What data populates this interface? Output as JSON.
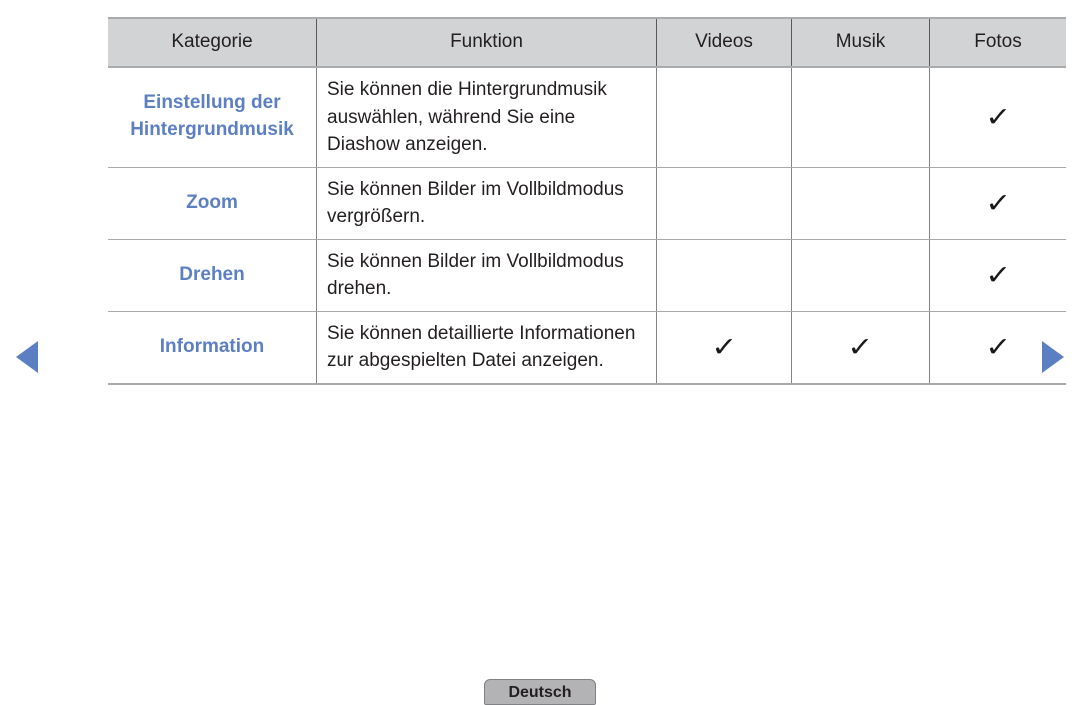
{
  "table": {
    "columns": [
      {
        "key": "kategorie",
        "label": "Kategorie"
      },
      {
        "key": "funktion",
        "label": "Funktion"
      },
      {
        "key": "videos",
        "label": "Videos"
      },
      {
        "key": "musik",
        "label": "Musik"
      },
      {
        "key": "fotos",
        "label": "Fotos"
      }
    ],
    "rows": [
      {
        "kategorie": "Einstellung der Hintergrundmusik",
        "funktion": "Sie können die Hintergrundmusik auswählen, während Sie eine Diashow anzeigen.",
        "videos": "",
        "musik": "",
        "fotos": "✓"
      },
      {
        "kategorie": "Zoom",
        "funktion": "Sie können Bilder im Vollbildmodus vergrößern.",
        "videos": "",
        "musik": "",
        "fotos": "✓"
      },
      {
        "kategorie": "Drehen",
        "funktion": "Sie können Bilder im Vollbildmodus drehen.",
        "videos": "",
        "musik": "",
        "fotos": "✓"
      },
      {
        "kategorie": "Information",
        "funktion": "Sie können detaillierte Informationen zur abgespielten Datei anzeigen.",
        "videos": "✓",
        "musik": "✓",
        "fotos": "✓"
      }
    ]
  },
  "navigation": {
    "previous_icon": "triangle-left-icon",
    "next_icon": "triangle-right-icon",
    "arrow_color": "#5c7fc4"
  },
  "footer": {
    "language_label": "Deutsch"
  },
  "colors": {
    "category_text": "#5c7fc4",
    "header_background": "#d2d3d5",
    "body_text": "#231f20",
    "button_background": "#b3b3b6"
  }
}
